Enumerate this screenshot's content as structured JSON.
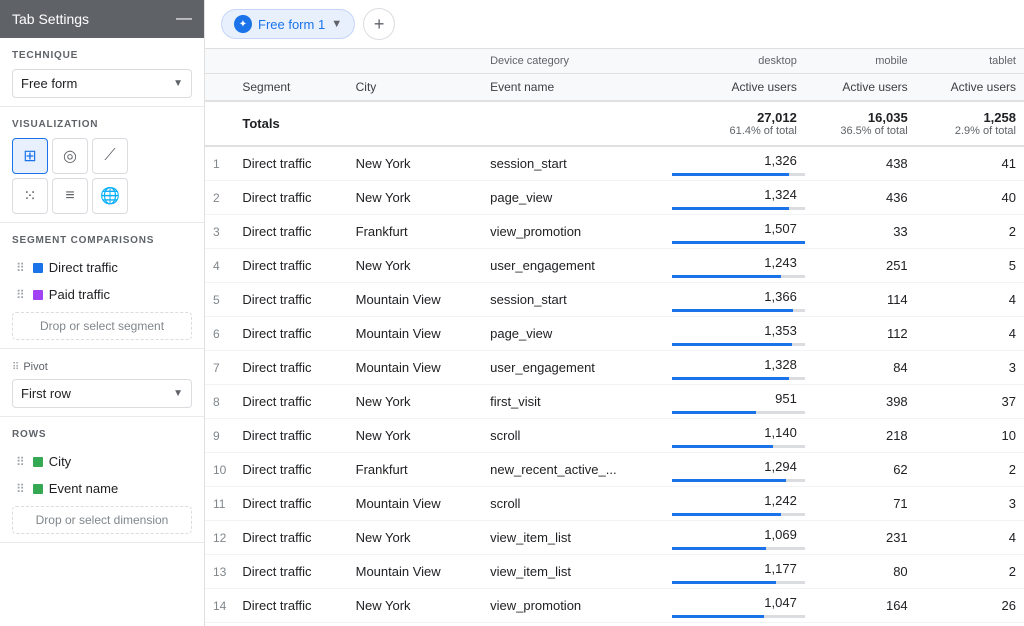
{
  "sidebar": {
    "title": "Tab Settings",
    "technique_label": "TECHNIQUE",
    "technique_value": "Free form",
    "visualization_label": "VISUALIZATION",
    "segment_comparisons_label": "SEGMENT COMPARISONS",
    "segments": [
      {
        "name": "Direct traffic",
        "color": "#1a73e8"
      },
      {
        "name": "Paid traffic",
        "color": "#a142f4"
      }
    ],
    "drop_segment_label": "Drop or select segment",
    "pivot_label": "Pivot",
    "pivot_value": "First row",
    "rows_label": "ROWS",
    "rows": [
      {
        "name": "City",
        "color": "#34a853"
      },
      {
        "name": "Event name",
        "color": "#34a853"
      }
    ],
    "drop_dimension_label": "Drop or select dimension",
    "minimize_icon": "—"
  },
  "topbar": {
    "tab_icon": "✦",
    "tab_label": "Free form 1",
    "add_tab_label": "+"
  },
  "table": {
    "span_header": [
      {
        "label": "",
        "colspan": 3
      },
      {
        "label": "Device category",
        "colspan": 1
      },
      {
        "label": "desktop",
        "colspan": 1
      },
      {
        "label": "mobile",
        "colspan": 1
      },
      {
        "label": "tablet",
        "colspan": 1
      }
    ],
    "col_headers": [
      {
        "label": "",
        "key": "num"
      },
      {
        "label": "Segment",
        "key": "segment"
      },
      {
        "label": "City",
        "key": "city"
      },
      {
        "label": "Event name",
        "key": "event_name"
      },
      {
        "label": "Active users",
        "key": "desktop_users",
        "num": true
      },
      {
        "label": "Active users",
        "key": "mobile_users",
        "num": true
      },
      {
        "label": "Active users",
        "key": "tablet_users",
        "num": true
      }
    ],
    "totals": {
      "label": "Totals",
      "desktop": "27,012",
      "desktop_sub": "61.4% of total",
      "mobile": "16,035",
      "mobile_sub": "36.5% of total",
      "tablet": "1,258",
      "tablet_sub": "2.9% of total"
    },
    "rows": [
      {
        "num": 1,
        "segment": "Direct traffic",
        "city": "New York",
        "event": "session_start",
        "desktop": 1326,
        "mobile": 438,
        "tablet": 41
      },
      {
        "num": 2,
        "segment": "Direct traffic",
        "city": "New York",
        "event": "page_view",
        "desktop": 1324,
        "mobile": 436,
        "tablet": 40
      },
      {
        "num": 3,
        "segment": "Direct traffic",
        "city": "Frankfurt",
        "event": "view_promotion",
        "desktop": 1507,
        "mobile": 33,
        "tablet": 2
      },
      {
        "num": 4,
        "segment": "Direct traffic",
        "city": "New York",
        "event": "user_engagement",
        "desktop": 1243,
        "mobile": 251,
        "tablet": 5
      },
      {
        "num": 5,
        "segment": "Direct traffic",
        "city": "Mountain View",
        "event": "session_start",
        "desktop": 1366,
        "mobile": 114,
        "tablet": 4
      },
      {
        "num": 6,
        "segment": "Direct traffic",
        "city": "Mountain View",
        "event": "page_view",
        "desktop": 1353,
        "mobile": 112,
        "tablet": 4
      },
      {
        "num": 7,
        "segment": "Direct traffic",
        "city": "Mountain View",
        "event": "user_engagement",
        "desktop": 1328,
        "mobile": 84,
        "tablet": 3
      },
      {
        "num": 8,
        "segment": "Direct traffic",
        "city": "New York",
        "event": "first_visit",
        "desktop": 951,
        "mobile": 398,
        "tablet": 37
      },
      {
        "num": 9,
        "segment": "Direct traffic",
        "city": "New York",
        "event": "scroll",
        "desktop": 1140,
        "mobile": 218,
        "tablet": 10
      },
      {
        "num": 10,
        "segment": "Direct traffic",
        "city": "Frankfurt",
        "event": "new_recent_active_...",
        "desktop": 1294,
        "mobile": 62,
        "tablet": 2
      },
      {
        "num": 11,
        "segment": "Direct traffic",
        "city": "Mountain View",
        "event": "scroll",
        "desktop": 1242,
        "mobile": 71,
        "tablet": 3
      },
      {
        "num": 12,
        "segment": "Direct traffic",
        "city": "New York",
        "event": "view_item_list",
        "desktop": 1069,
        "mobile": 231,
        "tablet": 4
      },
      {
        "num": 13,
        "segment": "Direct traffic",
        "city": "Mountain View",
        "event": "view_item_list",
        "desktop": 1177,
        "mobile": 80,
        "tablet": 2
      },
      {
        "num": 14,
        "segment": "Direct traffic",
        "city": "New York",
        "event": "view_promotion",
        "desktop": 1047,
        "mobile": 164,
        "tablet": 26
      }
    ],
    "max_desktop": 1507
  }
}
